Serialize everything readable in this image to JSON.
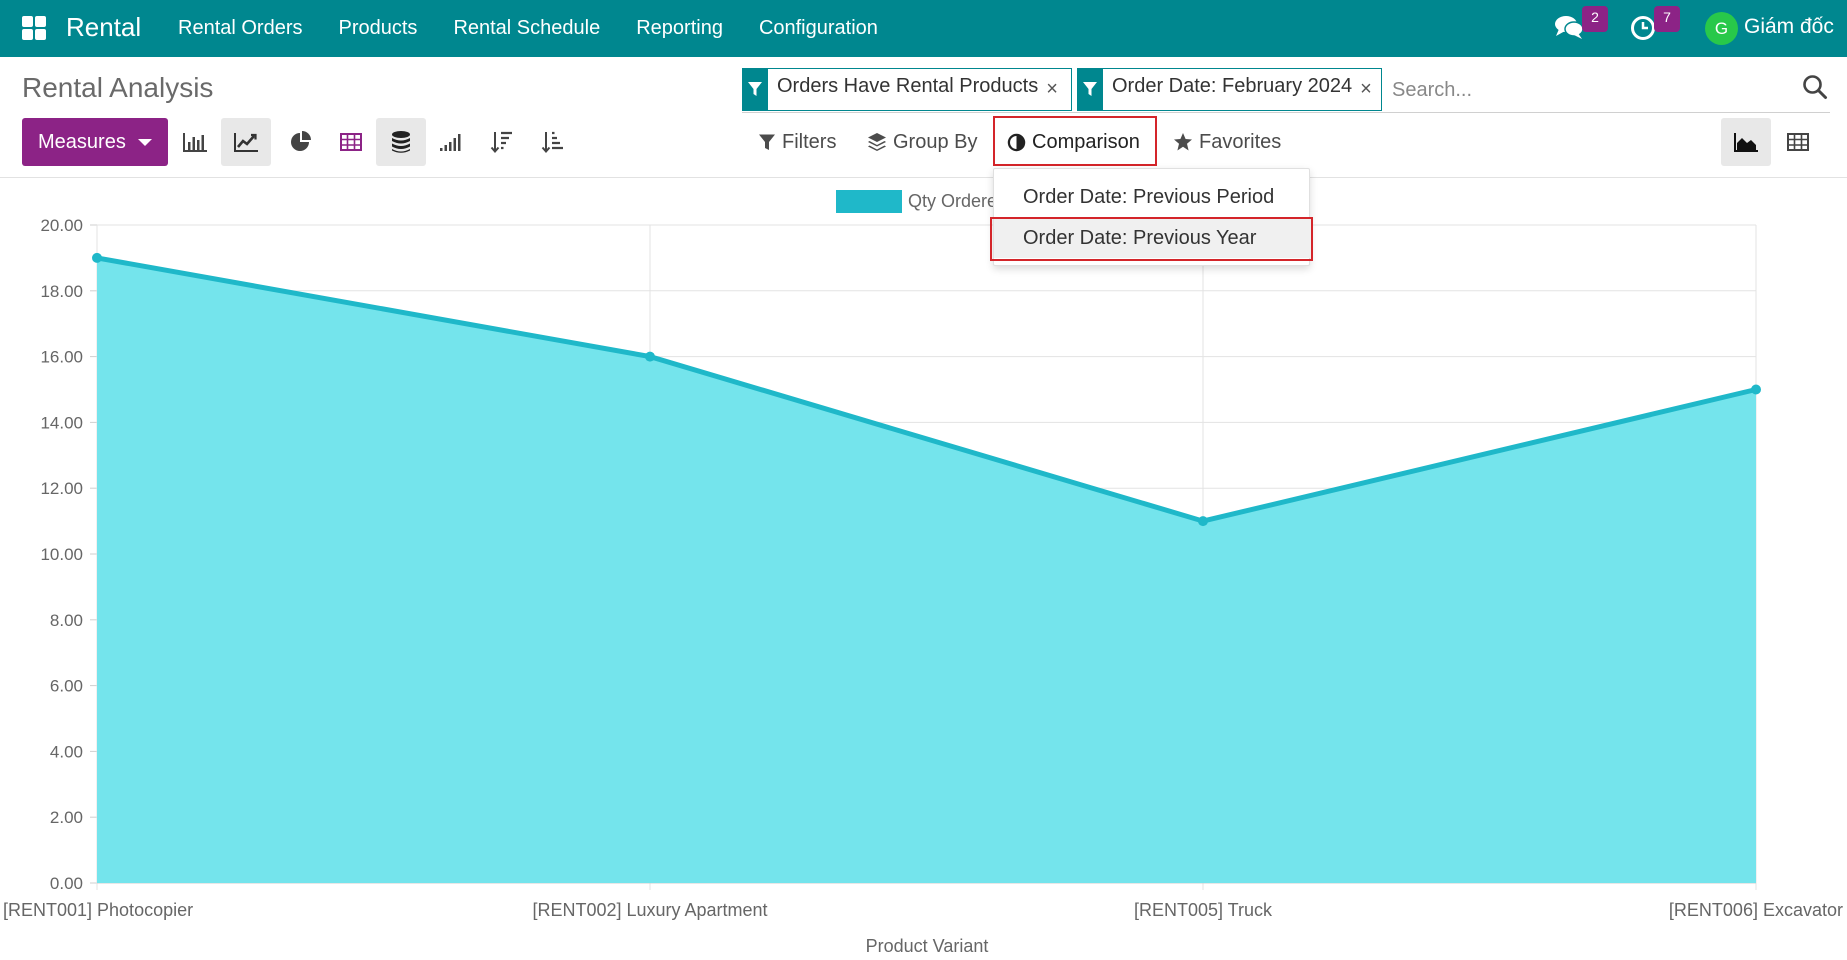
{
  "navbar": {
    "brand": "Rental",
    "menu": [
      "Rental Orders",
      "Products",
      "Rental Schedule",
      "Reporting",
      "Configuration"
    ],
    "messages_count": "2",
    "activities_count": "7",
    "avatar_initial": "G",
    "user_name": "Giám đốc"
  },
  "control_panel": {
    "title": "Rental Analysis",
    "facets": [
      "Orders Have Rental Products",
      "Order Date: February 2024"
    ],
    "search_placeholder": "Search...",
    "measures_label": "Measures",
    "filters_label": "Filters",
    "group_by_label": "Group By",
    "comparison_label": "Comparison",
    "favorites_label": "Favorites"
  },
  "comparison_dropdown": {
    "items": [
      "Order Date: Previous Period",
      "Order Date: Previous Year"
    ],
    "highlighted": "Order Date: Previous Year"
  },
  "colors": {
    "navbar": "#00878f",
    "primary": "#8c2386",
    "line": "#1fb8c9",
    "area": "#74e4ec",
    "highlight_box": "#d4252a"
  },
  "chart_data": {
    "type": "area",
    "categories": [
      "[RENT001] Photocopier",
      "[RENT002] Luxury Apartment",
      "[RENT005] Truck",
      "[RENT006] Excavator"
    ],
    "series": [
      {
        "name": "Qty Ordere",
        "values": [
          19,
          16,
          11,
          15
        ]
      }
    ],
    "xlabel": "Product Variant",
    "ylabel": "",
    "ylim": [
      0,
      20
    ],
    "yticks": [
      "0.00",
      "2.00",
      "4.00",
      "6.00",
      "8.00",
      "10.00",
      "12.00",
      "14.00",
      "16.00",
      "18.00",
      "20.00"
    ],
    "grid": true,
    "legend": "top-center"
  }
}
